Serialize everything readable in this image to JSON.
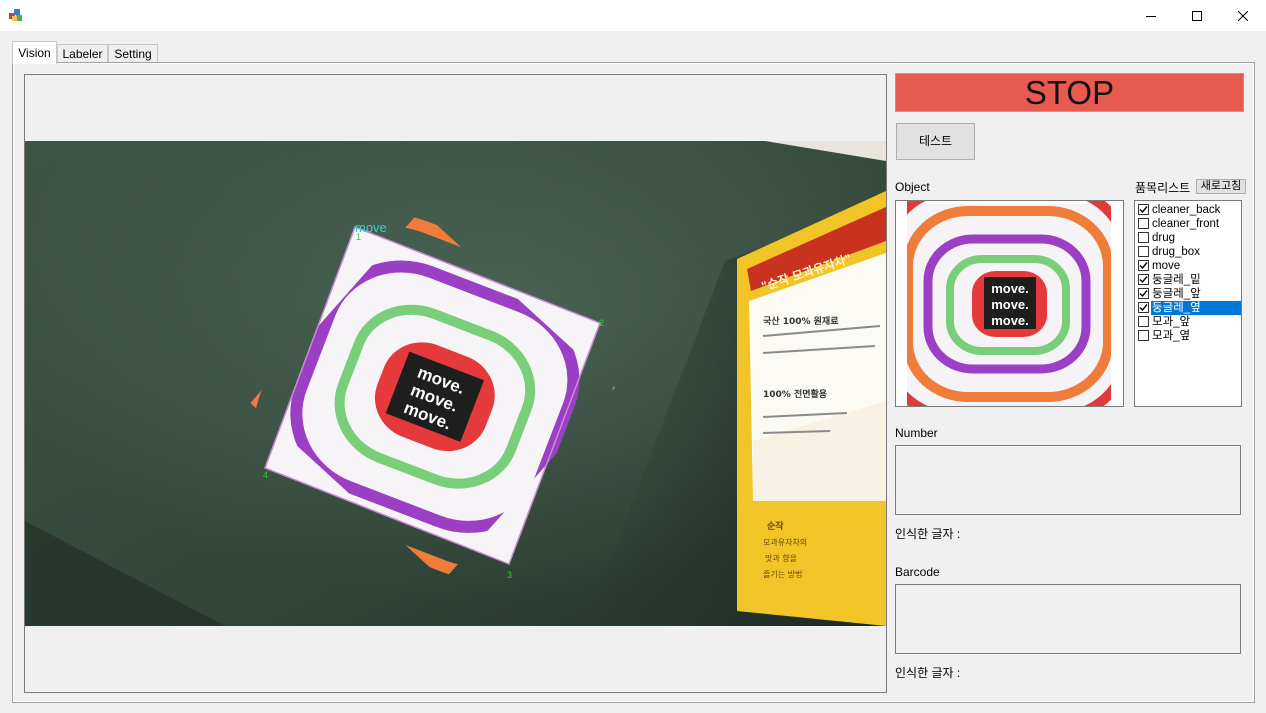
{
  "window": {
    "icon": "cube-app-icon",
    "controls": [
      "minimize-icon",
      "maximize-icon",
      "close-icon"
    ]
  },
  "tabs": [
    {
      "label": "Vision",
      "active": true
    },
    {
      "label": "Labeler",
      "active": false
    },
    {
      "label": "Setting",
      "active": false
    }
  ],
  "camera": {
    "detection_label": "move",
    "corner_labels": [
      "1",
      "2",
      "3",
      "4"
    ],
    "sticker_text": [
      "move.",
      "move.",
      "move."
    ],
    "box_text": {
      "heading": "\"순작 모과유자차\"",
      "line1": "국산 100% 원재료",
      "line2": "100% 전면활용",
      "side1": "순작",
      "side2": "모과유자차의",
      "side3": "맛과 향을",
      "side4": "즐기는 방법"
    }
  },
  "controls": {
    "stop_label": "STOP",
    "stop_color": "#e85a4f",
    "test_label": "테스트",
    "object_label": "Object",
    "list_label": "품목리스트",
    "refresh_label": "새로고침",
    "number_label": "Number",
    "number_result_label": "인식한 글자 :",
    "barcode_label": "Barcode",
    "barcode_result_label": "인식한 글자 :"
  },
  "items": [
    {
      "label": "cleaner_back",
      "checked": true,
      "selected": false
    },
    {
      "label": "cleaner_front",
      "checked": false,
      "selected": false
    },
    {
      "label": "drug",
      "checked": false,
      "selected": false
    },
    {
      "label": "drug_box",
      "checked": false,
      "selected": false
    },
    {
      "label": "move",
      "checked": true,
      "selected": false
    },
    {
      "label": "둥글레_밑",
      "checked": true,
      "selected": false
    },
    {
      "label": "둥글레_앞",
      "checked": true,
      "selected": false
    },
    {
      "label": "둥글레_옆",
      "checked": true,
      "selected": true
    },
    {
      "label": "모과_앞",
      "checked": false,
      "selected": false
    },
    {
      "label": "모과_옆",
      "checked": false,
      "selected": false
    }
  ]
}
